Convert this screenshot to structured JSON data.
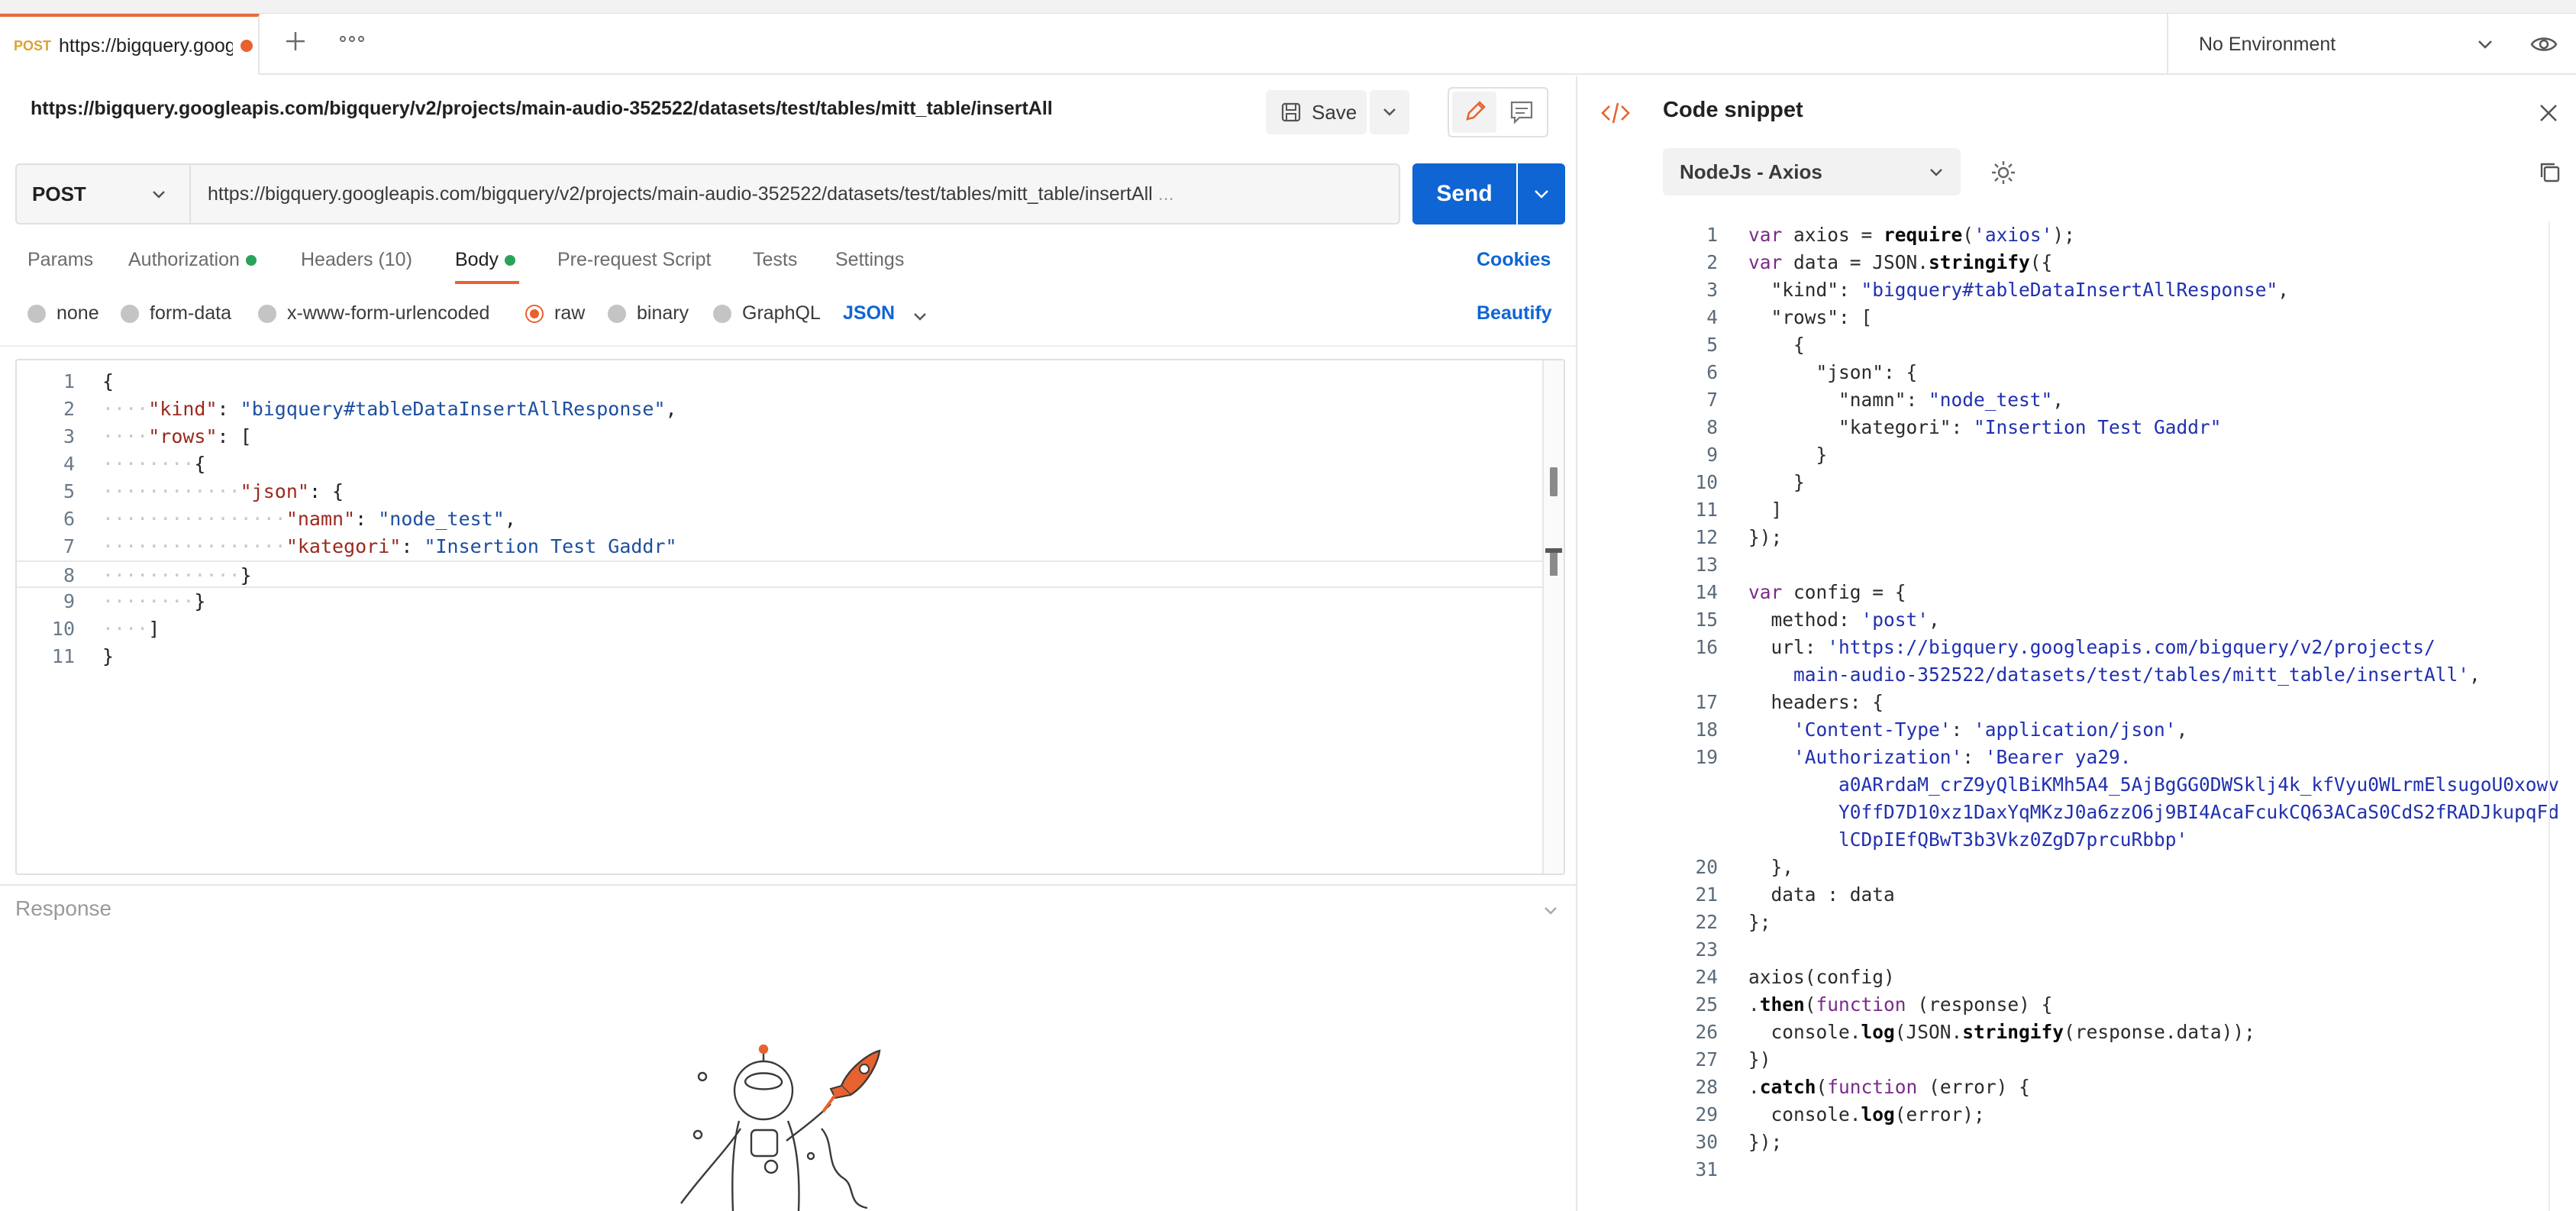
{
  "tab": {
    "method": "POST",
    "title": "https://bigquery.goog"
  },
  "environment": {
    "selected": "No Environment"
  },
  "request": {
    "url_title": "https://bigquery.googleapis.com/bigquery/v2/projects/main-audio-352522/datasets/test/tables/mitt_table/insertAll",
    "save_label": "Save",
    "method": "POST",
    "url": "https://bigquery.googleapis.com/bigquery/v2/projects/main-audio-352522/datasets/test/tables/mitt_table/insertAll",
    "url_ellipsis": "...",
    "send_label": "Send"
  },
  "req_tabs": {
    "params": "Params",
    "authorization": "Authorization",
    "headers": "Headers",
    "headers_count": "(10)",
    "body": "Body",
    "prerequest": "Pre-request Script",
    "tests": "Tests",
    "settings": "Settings",
    "cookies": "Cookies"
  },
  "body_options": {
    "none": "none",
    "form_data": "form-data",
    "urlencoded": "x-www-form-urlencoded",
    "raw": "raw",
    "binary": "binary",
    "graphql": "GraphQL",
    "language": "JSON",
    "beautify": "Beautify"
  },
  "editor": {
    "line_numbers": [
      "1",
      "2",
      "3",
      "4",
      "5",
      "6",
      "7",
      "8",
      "9",
      "10",
      "11"
    ],
    "current_line": 8,
    "lines": [
      [
        {
          "t": "{",
          "c": ""
        }
      ],
      [
        {
          "t": "····",
          "c": "ws"
        },
        {
          "t": "\"kind\"",
          "c": "k"
        },
        {
          "t": ": ",
          "c": ""
        },
        {
          "t": "\"bigquery#tableDataInsertAllResponse\"",
          "c": "s"
        },
        {
          "t": ",",
          "c": ""
        }
      ],
      [
        {
          "t": "····",
          "c": "ws"
        },
        {
          "t": "\"rows\"",
          "c": "k"
        },
        {
          "t": ": [",
          "c": ""
        }
      ],
      [
        {
          "t": "········",
          "c": "ws"
        },
        {
          "t": "{",
          "c": ""
        }
      ],
      [
        {
          "t": "············",
          "c": "ws"
        },
        {
          "t": "\"json\"",
          "c": "k"
        },
        {
          "t": ": {",
          "c": ""
        }
      ],
      [
        {
          "t": "················",
          "c": "ws"
        },
        {
          "t": "\"namn\"",
          "c": "k"
        },
        {
          "t": ": ",
          "c": ""
        },
        {
          "t": "\"node_test\"",
          "c": "s"
        },
        {
          "t": ",",
          "c": ""
        }
      ],
      [
        {
          "t": "················",
          "c": "ws"
        },
        {
          "t": "\"kategori\"",
          "c": "k"
        },
        {
          "t": ": ",
          "c": ""
        },
        {
          "t": "\"Insertion Test Gaddr\"",
          "c": "s"
        }
      ],
      [
        {
          "t": "············",
          "c": "ws"
        },
        {
          "t": "}",
          "c": ""
        }
      ],
      [
        {
          "t": "········",
          "c": "ws"
        },
        {
          "t": "}",
          "c": ""
        }
      ],
      [
        {
          "t": "····",
          "c": "ws"
        },
        {
          "t": "]",
          "c": ""
        }
      ],
      [
        {
          "t": "}",
          "c": ""
        }
      ]
    ]
  },
  "response": {
    "label": "Response"
  },
  "snippet": {
    "title": "Code snippet",
    "language": "NodeJs - Axios",
    "lines": [
      {
        "n": "1",
        "p": [
          {
            "t": "var ",
            "c": "kw"
          },
          {
            "t": "axios = ",
            "c": ""
          },
          {
            "t": "require",
            "c": "fn"
          },
          {
            "t": "(",
            "c": ""
          },
          {
            "t": "'axios'",
            "c": "str"
          },
          {
            "t": ");",
            "c": ""
          }
        ]
      },
      {
        "n": "2",
        "p": [
          {
            "t": "var ",
            "c": "kw"
          },
          {
            "t": "data = JSON.",
            "c": ""
          },
          {
            "t": "stringify",
            "c": "fn"
          },
          {
            "t": "({",
            "c": ""
          }
        ]
      },
      {
        "n": "3",
        "p": [
          {
            "t": "  \"kind\": ",
            "c": ""
          },
          {
            "t": "\"bigquery#tableDataInsertAllResponse\"",
            "c": "str"
          },
          {
            "t": ",",
            "c": ""
          }
        ]
      },
      {
        "n": "4",
        "p": [
          {
            "t": "  \"rows\": [",
            "c": ""
          }
        ]
      },
      {
        "n": "5",
        "p": [
          {
            "t": "    {",
            "c": ""
          }
        ]
      },
      {
        "n": "6",
        "p": [
          {
            "t": "      \"json\": {",
            "c": ""
          }
        ]
      },
      {
        "n": "7",
        "p": [
          {
            "t": "        \"namn\": ",
            "c": ""
          },
          {
            "t": "\"node_test\"",
            "c": "str"
          },
          {
            "t": ",",
            "c": ""
          }
        ]
      },
      {
        "n": "8",
        "p": [
          {
            "t": "        \"kategori\": ",
            "c": ""
          },
          {
            "t": "\"Insertion Test Gaddr\"",
            "c": "str"
          }
        ]
      },
      {
        "n": "9",
        "p": [
          {
            "t": "      }",
            "c": ""
          }
        ]
      },
      {
        "n": "10",
        "p": [
          {
            "t": "    }",
            "c": ""
          }
        ]
      },
      {
        "n": "11",
        "p": [
          {
            "t": "  ]",
            "c": ""
          }
        ]
      },
      {
        "n": "12",
        "p": [
          {
            "t": "});",
            "c": ""
          }
        ]
      },
      {
        "n": "13",
        "p": []
      },
      {
        "n": "14",
        "p": [
          {
            "t": "var ",
            "c": "kw"
          },
          {
            "t": "config = {",
            "c": ""
          }
        ]
      },
      {
        "n": "15",
        "p": [
          {
            "t": "  method: ",
            "c": ""
          },
          {
            "t": "'post'",
            "c": "str"
          },
          {
            "t": ",",
            "c": ""
          }
        ]
      },
      {
        "n": "16",
        "p": [
          {
            "t": "  url: ",
            "c": ""
          },
          {
            "t": "'https://bigquery.googleapis.com/bigquery/v2/projects/",
            "c": "str"
          }
        ]
      },
      {
        "n": "",
        "p": [
          {
            "t": "    main-audio-352522/datasets/test/tables/mitt_table/insertAll'",
            "c": "str"
          },
          {
            "t": ",",
            "c": ""
          }
        ]
      },
      {
        "n": "17",
        "p": [
          {
            "t": "  headers: {",
            "c": ""
          }
        ]
      },
      {
        "n": "18",
        "p": [
          {
            "t": "    ",
            "c": ""
          },
          {
            "t": "'Content-Type'",
            "c": "str"
          },
          {
            "t": ": ",
            "c": ""
          },
          {
            "t": "'application/json'",
            "c": "str"
          },
          {
            "t": ",",
            "c": ""
          }
        ]
      },
      {
        "n": "19",
        "p": [
          {
            "t": "    ",
            "c": ""
          },
          {
            "t": "'Authorization'",
            "c": "str"
          },
          {
            "t": ": ",
            "c": ""
          },
          {
            "t": "'Bearer ya29.",
            "c": "str"
          }
        ]
      },
      {
        "n": "",
        "p": [
          {
            "t": "        a0ARrdaM_crZ9yQlBiKMh5A4_5AjBgGG0DWSklj4k_kfVyu0WLrmElsugoU0xowv",
            "c": "str"
          }
        ]
      },
      {
        "n": "",
        "p": [
          {
            "t": "        Y0ffD7D10xz1DaxYqMKzJ0a6zzO6j9BI4AcaFcukCQ63ACaS0CdS2fRADJkupqFd",
            "c": "str"
          }
        ]
      },
      {
        "n": "",
        "p": [
          {
            "t": "        lCDpIEfQBwT3b3Vkz0ZgD7prcuRbbp'",
            "c": "str"
          }
        ]
      },
      {
        "n": "20",
        "p": [
          {
            "t": "  },",
            "c": ""
          }
        ]
      },
      {
        "n": "21",
        "p": [
          {
            "t": "  data : data",
            "c": ""
          }
        ]
      },
      {
        "n": "22",
        "p": [
          {
            "t": "};",
            "c": ""
          }
        ]
      },
      {
        "n": "23",
        "p": []
      },
      {
        "n": "24",
        "p": [
          {
            "t": "axios(config)",
            "c": ""
          }
        ]
      },
      {
        "n": "25",
        "p": [
          {
            "t": ".",
            "c": ""
          },
          {
            "t": "then",
            "c": "fn"
          },
          {
            "t": "(",
            "c": ""
          },
          {
            "t": "function ",
            "c": "kw"
          },
          {
            "t": "(response) {",
            "c": ""
          }
        ]
      },
      {
        "n": "26",
        "p": [
          {
            "t": "  console.",
            "c": ""
          },
          {
            "t": "log",
            "c": "fn"
          },
          {
            "t": "(JSON.",
            "c": ""
          },
          {
            "t": "stringify",
            "c": "fn"
          },
          {
            "t": "(response.data));",
            "c": ""
          }
        ]
      },
      {
        "n": "27",
        "p": [
          {
            "t": "})",
            "c": ""
          }
        ]
      },
      {
        "n": "28",
        "p": [
          {
            "t": ".",
            "c": ""
          },
          {
            "t": "catch",
            "c": "fn"
          },
          {
            "t": "(",
            "c": ""
          },
          {
            "t": "function ",
            "c": "kw"
          },
          {
            "t": "(error) {",
            "c": ""
          }
        ]
      },
      {
        "n": "29",
        "p": [
          {
            "t": "  console.",
            "c": ""
          },
          {
            "t": "log",
            "c": "fn"
          },
          {
            "t": "(error);",
            "c": ""
          }
        ]
      },
      {
        "n": "30",
        "p": [
          {
            "t": "});",
            "c": ""
          }
        ]
      },
      {
        "n": "31",
        "p": []
      }
    ]
  },
  "colors": {
    "accent": "#e8622f",
    "primary_blue": "#0f65d3",
    "status_green": "#29a35a"
  },
  "icons": [
    "plus-icon",
    "more-icon",
    "chevron-down-icon",
    "eye-icon",
    "save-icon",
    "pencil-icon",
    "comment-icon",
    "code-icon",
    "close-icon",
    "gear-icon",
    "copy-icon",
    "astronaut-illustration"
  ]
}
